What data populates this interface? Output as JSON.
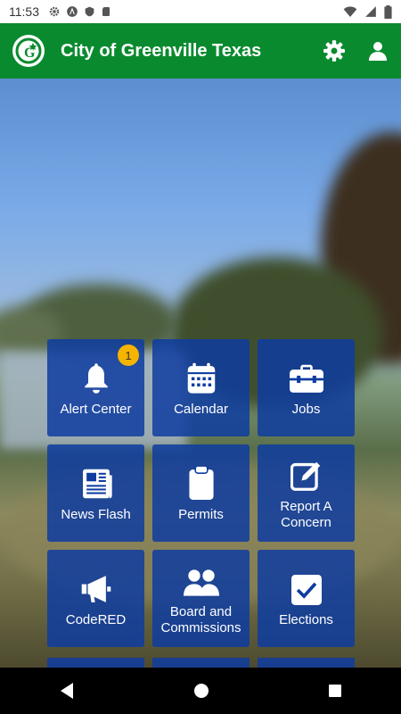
{
  "status": {
    "time": "11:53"
  },
  "header": {
    "title": "City of Greenville Texas"
  },
  "tiles": [
    {
      "label": "Alert Center",
      "badge": "1"
    },
    {
      "label": "Calendar"
    },
    {
      "label": "Jobs"
    },
    {
      "label": "News Flash"
    },
    {
      "label": "Permits"
    },
    {
      "label": "Report A\nConcern"
    },
    {
      "label": "CodeRED"
    },
    {
      "label": "Board and\nCommissions"
    },
    {
      "label": "Elections"
    }
  ],
  "colors": {
    "appbar": "#0a8a2f",
    "tile": "#0e3ca0",
    "badge": "#f4b400"
  }
}
